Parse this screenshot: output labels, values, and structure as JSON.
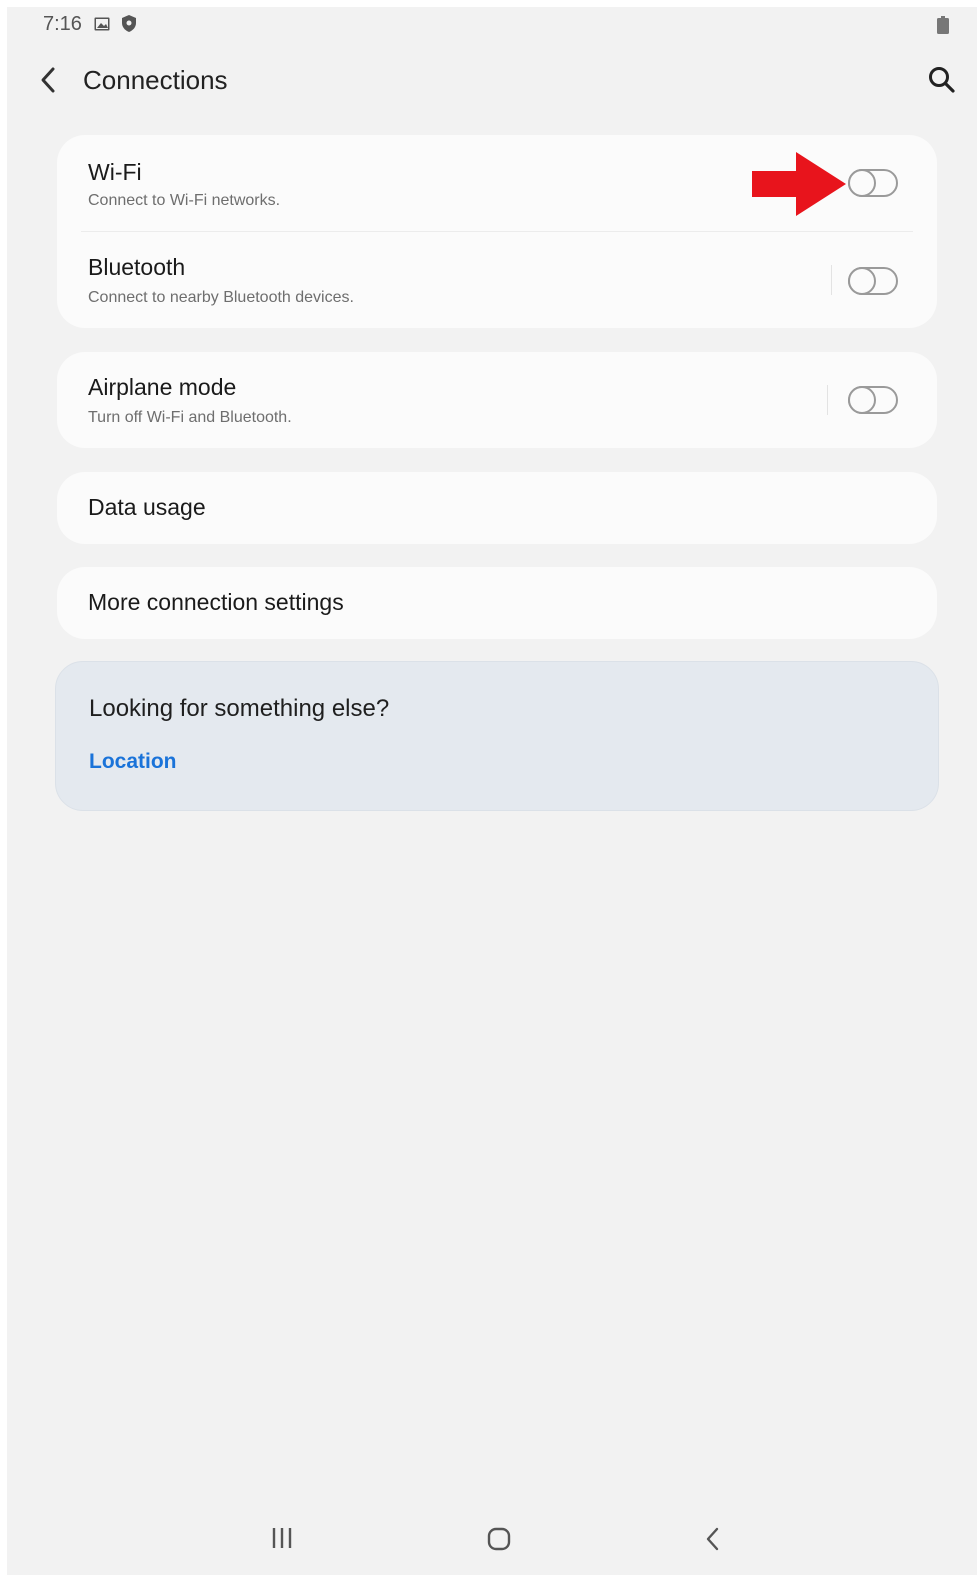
{
  "status_bar": {
    "time": "7:16",
    "icons": [
      "gallery-icon",
      "shield-icon",
      "battery-icon"
    ]
  },
  "header": {
    "title": "Connections",
    "back_icon": "back-arrow-icon",
    "search_icon": "search-icon"
  },
  "cards": {
    "wifi": {
      "title": "Wi-Fi",
      "subtitle": "Connect to Wi-Fi networks.",
      "enabled": false
    },
    "bluetooth": {
      "title": "Bluetooth",
      "subtitle": "Connect to nearby Bluetooth devices.",
      "enabled": false
    },
    "airplane": {
      "title": "Airplane mode",
      "subtitle": "Turn off Wi-Fi and Bluetooth.",
      "enabled": false
    },
    "data_usage": {
      "title": "Data usage"
    },
    "more_settings": {
      "title": "More connection settings"
    }
  },
  "callout": {
    "title": "Looking for something else?",
    "link": "Location"
  },
  "annotation": {
    "icon": "red-arrow-icon",
    "color": "#e8141c"
  },
  "nav_bar": {
    "icons": [
      "recents-icon",
      "home-icon",
      "back-icon"
    ]
  },
  "colors": {
    "background": "#f2f2f2",
    "card": "#fbfbfb",
    "link": "#1a73d9",
    "callout_bg": "#e4e9ef"
  }
}
